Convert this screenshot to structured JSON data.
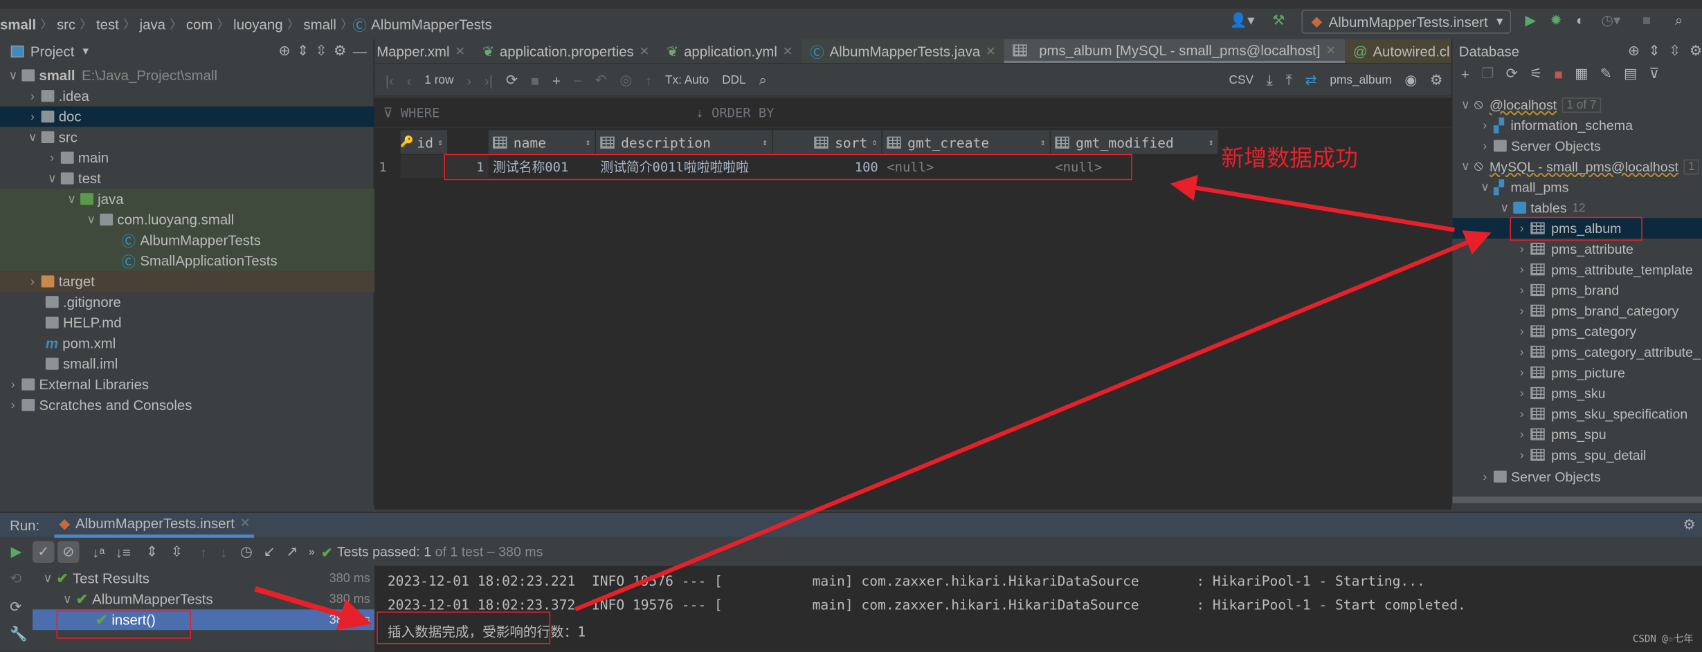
{
  "breadcrumb": [
    "small",
    "src",
    "test",
    "java",
    "com",
    "luoyang",
    "small",
    "AlbumMapperTests"
  ],
  "run_config": "AlbumMapperTests.insert",
  "project": {
    "title": "Project",
    "root": {
      "name": "small",
      "path": "E:\\Java_Project\\small"
    },
    "items": [
      ".idea",
      "doc",
      "src",
      "main",
      "test",
      "java",
      "com.luoyang.small",
      "AlbumMapperTests",
      "SmallApplicationTests",
      "target",
      ".gitignore",
      "HELP.md",
      "pom.xml",
      "small.iml",
      "External Libraries",
      "Scratches and Consoles"
    ]
  },
  "tabs": [
    {
      "label": "Mapper.xml"
    },
    {
      "label": "application.properties"
    },
    {
      "label": "application.yml"
    },
    {
      "label": "AlbumMapperTests.java"
    },
    {
      "label": "pms_album [MySQL - small_pms@localhost]"
    },
    {
      "label": "Autowired.cl"
    }
  ],
  "db_toolbar": {
    "rows": "1 row",
    "tx": "Tx: Auto",
    "ddl": "DDL",
    "export": "CSV",
    "table": "pms_album"
  },
  "filter": {
    "where": "WHERE",
    "order_by": "ORDER BY"
  },
  "grid": {
    "columns": [
      "id",
      "name",
      "description",
      "sort",
      "gmt_create",
      "gmt_modified"
    ],
    "rows": [
      {
        "num": "1",
        "cells": [
          "1",
          "测试名称001",
          "测试简介001l啦啦啦啦啦",
          "100",
          "<null>",
          "<null>"
        ]
      }
    ]
  },
  "annotation": "新增数据成功",
  "database": {
    "title": "Database",
    "localhost": "@localhost",
    "localhost_badge": "1 of 7",
    "information_schema": "information_schema",
    "server_objects": "Server Objects",
    "connection": "MySQL - small_pms@localhost",
    "connection_badge": "1",
    "schema": "mall_pms",
    "tables_label": "tables",
    "tables_count": "12",
    "tables": [
      "pms_album",
      "pms_attribute",
      "pms_attribute_template",
      "pms_brand",
      "pms_brand_category",
      "pms_category",
      "pms_category_attribute_",
      "pms_picture",
      "pms_sku",
      "pms_sku_specification",
      "pms_spu",
      "pms_spu_detail"
    ],
    "server_objects2": "Server Objects"
  },
  "run": {
    "label": "Run:",
    "tab": "AlbumMapperTests.insert",
    "status_prefix": "Tests passed:",
    "status_count": "1",
    "status_rest": "of 1 test – 380 ms",
    "tree": [
      {
        "label": "Test Results",
        "time": "380 ms"
      },
      {
        "label": "AlbumMapperTests",
        "time": "380 ms"
      },
      {
        "label": "insert()",
        "time": "380 ms"
      }
    ],
    "console": [
      "2023-12-01 18:02:23.221  INFO 19576 --- [           main] com.zaxxer.hikari.HikariDataSource       : HikariPool-1 - Starting...",
      "2023-12-01 18:02:23.372  INFO 19576 --- [           main] com.zaxxer.hikari.HikariDataSource       : HikariPool-1 - Start completed.",
      "插入数据完成，受影响的行数：1"
    ]
  },
  "watermark": "CSDN @☆七年",
  "colors": {
    "annotation": "#e8202a",
    "selection": "#0d293e",
    "run_selection": "#4b6eaf",
    "pass": "#5fa545"
  }
}
